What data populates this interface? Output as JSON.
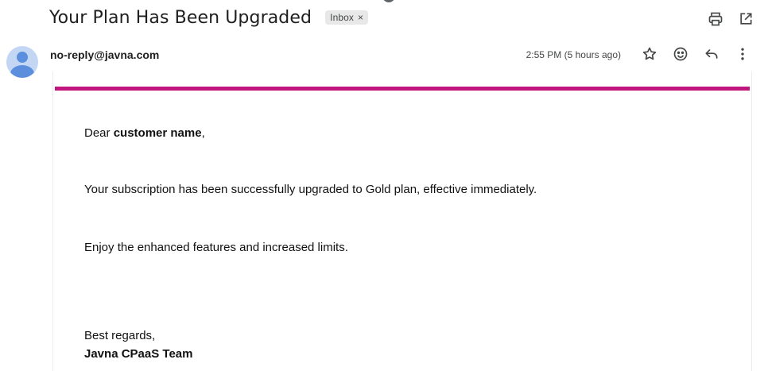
{
  "email": {
    "subject": "Your Plan Has Been Upgraded",
    "label": "Inbox",
    "label_close": "×",
    "sender": "no-reply@javna.com",
    "timestamp": "2:55 PM (5 hours ago)"
  },
  "icons": {
    "print": "print-icon",
    "open_new": "open-in-new-window-icon",
    "star": "star-icon",
    "emoji": "emoji-reaction-icon",
    "reply": "reply-icon",
    "more": "more-vertical-icon",
    "avatar": "default-avatar-icon"
  },
  "colors": {
    "accent_bar": "#c0167e",
    "avatar_bg": "#c3d7f4",
    "avatar_fg": "#5b8fde"
  },
  "body": {
    "greeting_prefix": "Dear ",
    "greeting_name": "customer name",
    "greeting_suffix": ",",
    "line1": "Your subscription has been successfully upgraded to Gold plan, effective immediately.",
    "line2": "Enjoy the enhanced features and increased limits.",
    "signoff": "Best regards,",
    "team": "Javna CPaaS Team"
  }
}
